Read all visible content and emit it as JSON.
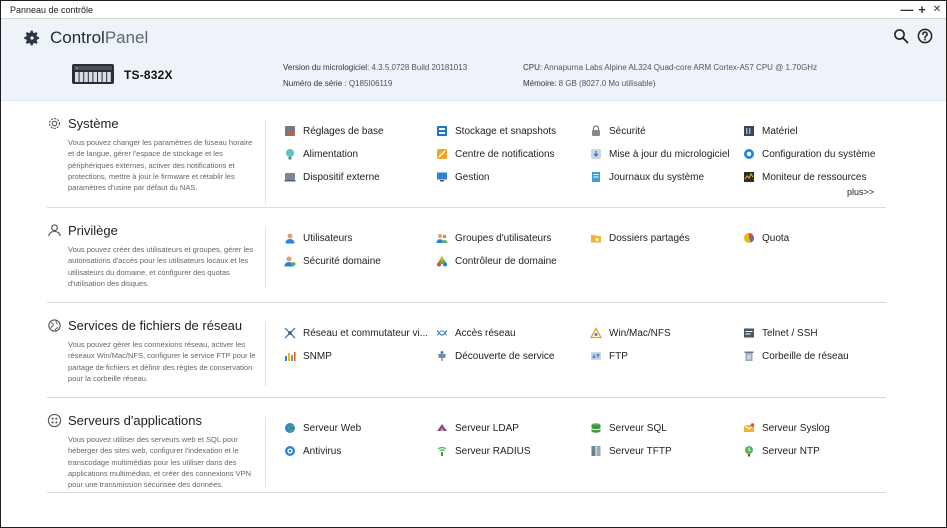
{
  "window": {
    "title": "Panneau de contrôle",
    "minimize": "—",
    "maximize": "+",
    "close": "✕"
  },
  "header": {
    "brand_bold": "Control",
    "brand_light": "Panel",
    "model": "TS-832X",
    "firmware_label": "Version du micrologiciel:",
    "firmware_value": "4.3.5.0728 Build 20181013",
    "serial_label": "Numéro de série :",
    "serial_value": "Q185I06119",
    "cpu_label": "CPU:",
    "cpu_value": "Annapurna Labs Alpine AL324 Quad-core ARM Cortex-A57 CPU @ 1.70GHz",
    "memory_label": "Mémoire:",
    "memory_value": "8 GB (8027.0 Mo utilisable)"
  },
  "sections": [
    {
      "title": "Système",
      "desc": "Vous pouvez changer les paramètres de fuseau horaire et de langue, gérer l'espace de stockage et les périphériques externes, activer des notifications et protections, mettre à jour le firmware et rétablir les paramètres d'usine par défaut du NAS.",
      "more": "plus>>",
      "items": [
        "Réglages de base",
        "Stockage et snapshots",
        "Sécurité",
        "Matériel",
        "Alimentation",
        "Centre de notifications",
        "Mise à jour du micrologiciel",
        "Configuration du système",
        "Dispositif externe",
        "Gestion",
        "Journaux du système",
        "Moniteur de ressources"
      ]
    },
    {
      "title": "Privilège",
      "desc": "Vous pouvez créer des utilisateurs et groupes, gérer les autorisations d'accès pour les utilisateurs locaux et les utilisateurs du domaine, et configurer des quotas d'utilisation des disques.",
      "items": [
        "Utilisateurs",
        "Groupes d'utilisateurs",
        "Dossiers partagés",
        "Quota",
        "Sécurité domaine",
        "Contrôleur de domaine"
      ]
    },
    {
      "title": "Services de fichiers de réseau",
      "desc": "Vous pouvez gérer les connexions réseau, activer les réseaux Win/Mac/NFS, configurer le service FTP pour le partage de fichiers et définir des règles de conservation pour la corbeille réseau.",
      "items": [
        "Réseau et commutateur vi...",
        "Accès réseau",
        "Win/Mac/NFS",
        "Telnet / SSH",
        "SNMP",
        "Découverte de service",
        "FTP",
        "Corbeille de réseau"
      ]
    },
    {
      "title": "Serveurs d'applications",
      "desc": "Vous pouvez utiliser des serveurs web et SQL pour héberger des sites web, configurer l'indexation et le transcodage multimédias pour les utiliser dans des applications multimédias, et créer des connexions VPN pour une transmission sécurisée des données.",
      "items": [
        "Serveur Web",
        "Serveur LDAP",
        "Serveur SQL",
        "Serveur Syslog",
        "Antivirus",
        "Serveur RADIUS",
        "Serveur TFTP",
        "Serveur NTP"
      ]
    }
  ],
  "icons": {
    "sections": [
      "gear-icon",
      "user-icon",
      "network-globe-icon",
      "apps-icon"
    ],
    "system": [
      "basic-settings-icon",
      "storage-icon",
      "lock-icon",
      "hardware-icon",
      "power-icon",
      "notification-icon",
      "firmware-update-icon",
      "system-config-icon",
      "external-device-icon",
      "management-icon",
      "logs-icon",
      "resource-monitor-icon"
    ],
    "privilege": [
      "users-icon",
      "user-groups-icon",
      "shared-folders-icon",
      "quota-icon",
      "domain-security-icon",
      "domain-controller-icon"
    ],
    "network": [
      "network-switch-icon",
      "network-access-icon",
      "win-mac-nfs-icon",
      "terminal-icon",
      "snmp-icon",
      "service-discovery-icon",
      "ftp-icon",
      "recycle-bin-icon"
    ],
    "apps": [
      "web-server-icon",
      "ldap-icon",
      "sql-icon",
      "syslog-icon",
      "antivirus-icon",
      "radius-icon",
      "tftp-icon",
      "ntp-icon"
    ]
  },
  "colors": {
    "header_bg": "#eef3fa",
    "accent": "#1e88d8",
    "text": "#222222"
  }
}
